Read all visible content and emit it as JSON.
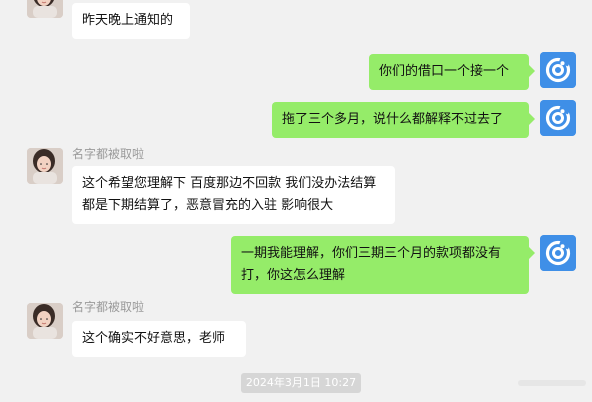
{
  "messages": [
    {
      "sender_name": "",
      "text": "昨天晚上通知的"
    },
    {
      "sender_name": "",
      "text": "你们的借口一个接一个"
    },
    {
      "sender_name": "",
      "text": "拖了三个多月，说什么都解释不过去了"
    },
    {
      "sender_name": "名字都被取啦",
      "text": "这个希望您理解下 百度那边不回款 我们没办法结算 都是下期结算了，恶意冒充的入驻 影响很大"
    },
    {
      "sender_name": "",
      "text": "一期我能理解，你们三期三个月的款项都没有打，你这怎么理解"
    },
    {
      "sender_name": "名字都被取啦",
      "text": "这个确实不好意思，老师"
    }
  ],
  "timestamp": "2024年3月1日 10:27",
  "colors": {
    "background": "#f1f1f1",
    "outgoing_bubble": "#95ec69",
    "incoming_bubble": "#ffffff",
    "app_avatar": "#3f8fe7"
  },
  "icons": {
    "contact_avatar": "girl-photo-avatar",
    "self_avatar": "blue-app-logo-icon"
  }
}
